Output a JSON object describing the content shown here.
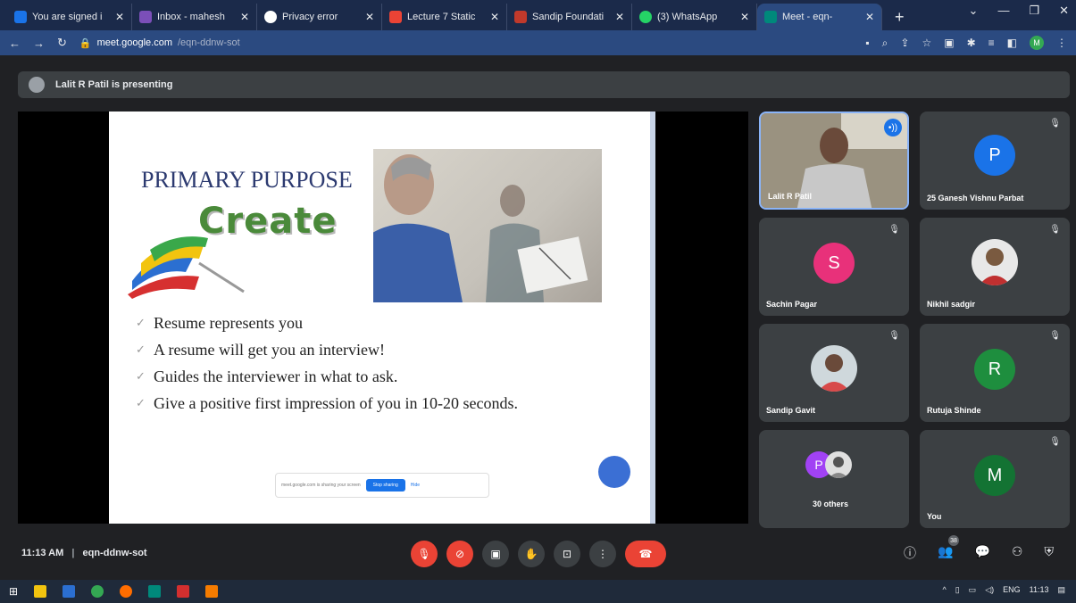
{
  "browser": {
    "tabs": [
      {
        "title": "You are signed i",
        "fav_color": "#1a73e8"
      },
      {
        "title": "Inbox - mahesh",
        "fav_color": "#7b4fb8"
      },
      {
        "title": "Privacy error",
        "fav_color": "#ffffff"
      },
      {
        "title": "Lecture 7 Static",
        "fav_color": "#ea4335"
      },
      {
        "title": "Sandip Foundati",
        "fav_color": "#c0392b"
      },
      {
        "title": "(3) WhatsApp",
        "fav_color": "#25d366"
      },
      {
        "title": "Meet - eqn-",
        "fav_color": "#00897b"
      }
    ],
    "url_host": "meet.google.com",
    "url_path": "/eqn-ddnw-sot",
    "profile_initial": "M"
  },
  "presenting": {
    "text": "Lalit R Patil is presenting"
  },
  "slide": {
    "title": "PRIMARY PURPOSE",
    "word_art": "Create",
    "bullets": [
      "Resume represents you",
      "A resume will get you an interview!",
      "Guides the interviewer in what to ask.",
      "Give a positive first impression of you in 10-20 seconds."
    ],
    "share_text": "meet.google.com is sharing your screen",
    "share_button": "Stop sharing",
    "hide_label": "Hide"
  },
  "participants": [
    {
      "name": "Lalit R Patil",
      "type": "video",
      "speaking": true
    },
    {
      "name": "25 Ganesh Vishnu Parbat",
      "initial": "P",
      "color": "#1a73e8"
    },
    {
      "name": "Sachin Pagar",
      "initial": "S",
      "color": "#e8317a"
    },
    {
      "name": "Nikhil sadgir",
      "type": "photo"
    },
    {
      "name": "Sandip Gavit",
      "type": "photo"
    },
    {
      "name": "Rutuja Shinde",
      "initial": "R",
      "color": "#1e8e3e"
    },
    {
      "name": "30 others",
      "initial": "P",
      "color": "#a142f4"
    },
    {
      "name": "You",
      "initial": "M",
      "color": "#137333"
    }
  ],
  "meeting": {
    "time": "11:13 AM",
    "separator": "|",
    "code": "eqn-ddnw-sot",
    "participant_count": "38"
  },
  "taskbar": {
    "lang": "ENG",
    "clock": "11:13"
  }
}
